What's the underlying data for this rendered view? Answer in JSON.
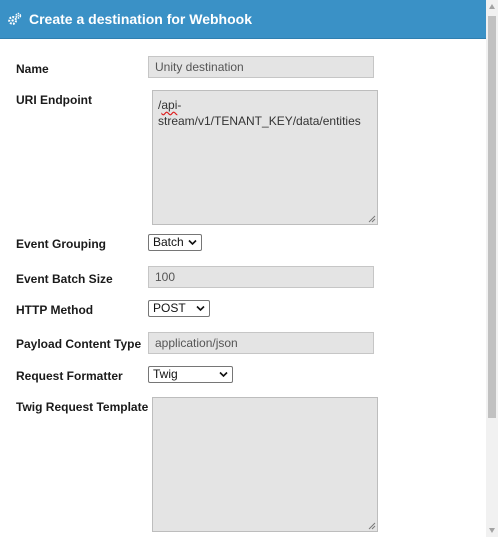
{
  "dialog": {
    "title": "Create a destination for Webhook",
    "title_icon": "gears-icon",
    "header_color": "#3a91c6"
  },
  "form": {
    "name": {
      "label": "Name",
      "value": "Unity destination"
    },
    "uri_endpoint": {
      "label": "URI Endpoint",
      "value_part1": "/",
      "value_part2": "api",
      "value_part3": "-stream/v1/TENANT_KEY/data/entities"
    },
    "event_grouping": {
      "label": "Event Grouping",
      "selected": "Batch"
    },
    "event_batch_size": {
      "label": "Event Batch Size",
      "value": "100"
    },
    "http_method": {
      "label": "HTTP Method",
      "selected": "POST"
    },
    "payload_content_type": {
      "label": "Payload Content Type",
      "value": "application/json"
    },
    "request_formatter": {
      "label": "Request Formatter",
      "selected": "Twig"
    },
    "twig_request_template": {
      "label": "Twig Request Template",
      "value": ""
    }
  }
}
